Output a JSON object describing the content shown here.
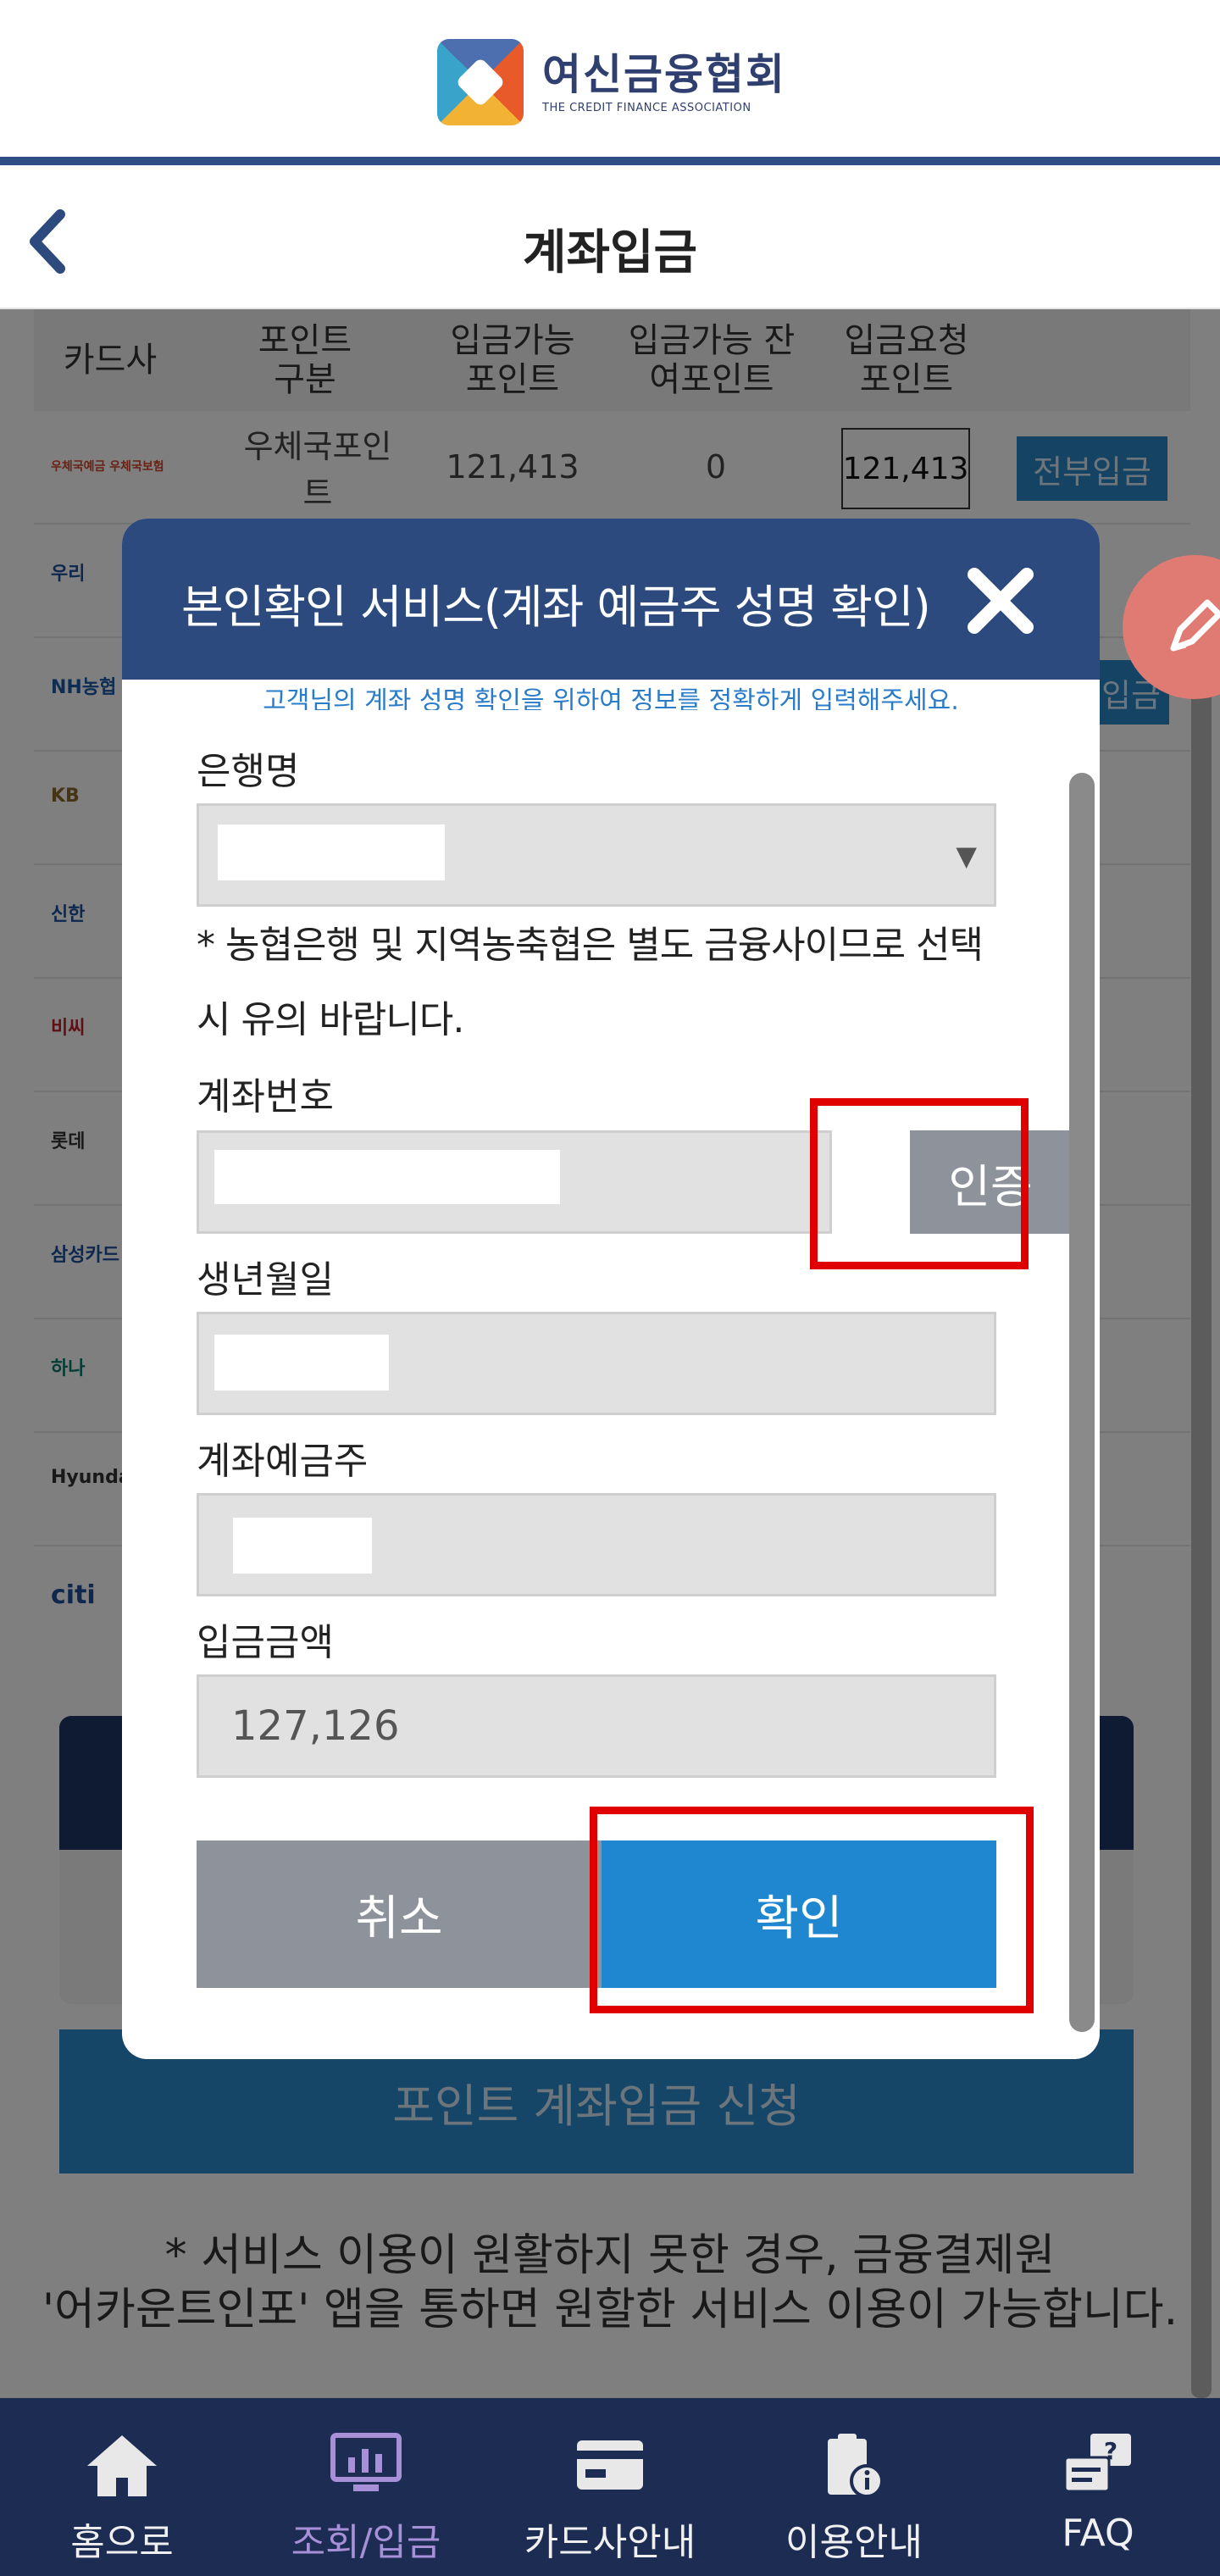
{
  "header": {
    "logo_kr": "여신금융협회",
    "logo_en": "THE CREDIT FINANCE ASSOCIATION",
    "page_title": "계좌입금"
  },
  "table": {
    "headers": [
      "카드사",
      "포인트 구분",
      "입금가능 포인트",
      "입금가능 잔여포인트",
      "입금요청 포인트"
    ],
    "first_row": {
      "brand": "우체국예금 우체국보험",
      "type": "우체국포인트",
      "available": "121,413",
      "remaining": "0",
      "requested": "121,413",
      "action": "전부입금"
    },
    "second_action": "입금",
    "side_brands": [
      "우리",
      "NH농협",
      "KB",
      "신한",
      "비씨",
      "롯데",
      "삼성카드",
      "하나",
      "Hyundai",
      "citi"
    ]
  },
  "bottom": {
    "apply_button": "포인트 계좌입금 신청",
    "notice_line1": "* 서비스 이용이 원활하지 못한 경우, 금융결제원",
    "notice_line2": "'어카운트인포' 앱을 통하면 원할한 서비스 이용이 가능합니다."
  },
  "modal": {
    "title": "본인확인 서비스(계좌 예금주 성명 확인)",
    "guide": "고객님의 계좌 성명 확인을 위하여 정보를 정확하게 입력해주세요.",
    "bank_label": "은행명",
    "bank_note": "* 농협은행 및 지역농축협은 별도 금융사이므로 선택시 유의 바랍니다.",
    "account_label": "계좌번호",
    "verify_button": "인증",
    "birth_label": "생년월일",
    "holder_label": "계좌예금주",
    "amount_label": "입금금액",
    "amount_value": "127,126",
    "cancel_button": "취소",
    "confirm_button": "확인"
  },
  "nav": {
    "items": [
      {
        "label": "홈으로",
        "icon": "home-icon"
      },
      {
        "label": "조회/입금",
        "icon": "lookup-deposit-icon"
      },
      {
        "label": "카드사안내",
        "icon": "card-icon"
      },
      {
        "label": "이용안내",
        "icon": "guide-icon"
      },
      {
        "label": "FAQ",
        "icon": "faq-icon"
      }
    ],
    "active_index": 1
  },
  "colors": {
    "primary_navy": "#2c4a7d",
    "nav_bg": "#1c2c52",
    "button_blue": "#1f87cf",
    "button_gray": "#8e939b",
    "highlight_red": "#e00000"
  }
}
